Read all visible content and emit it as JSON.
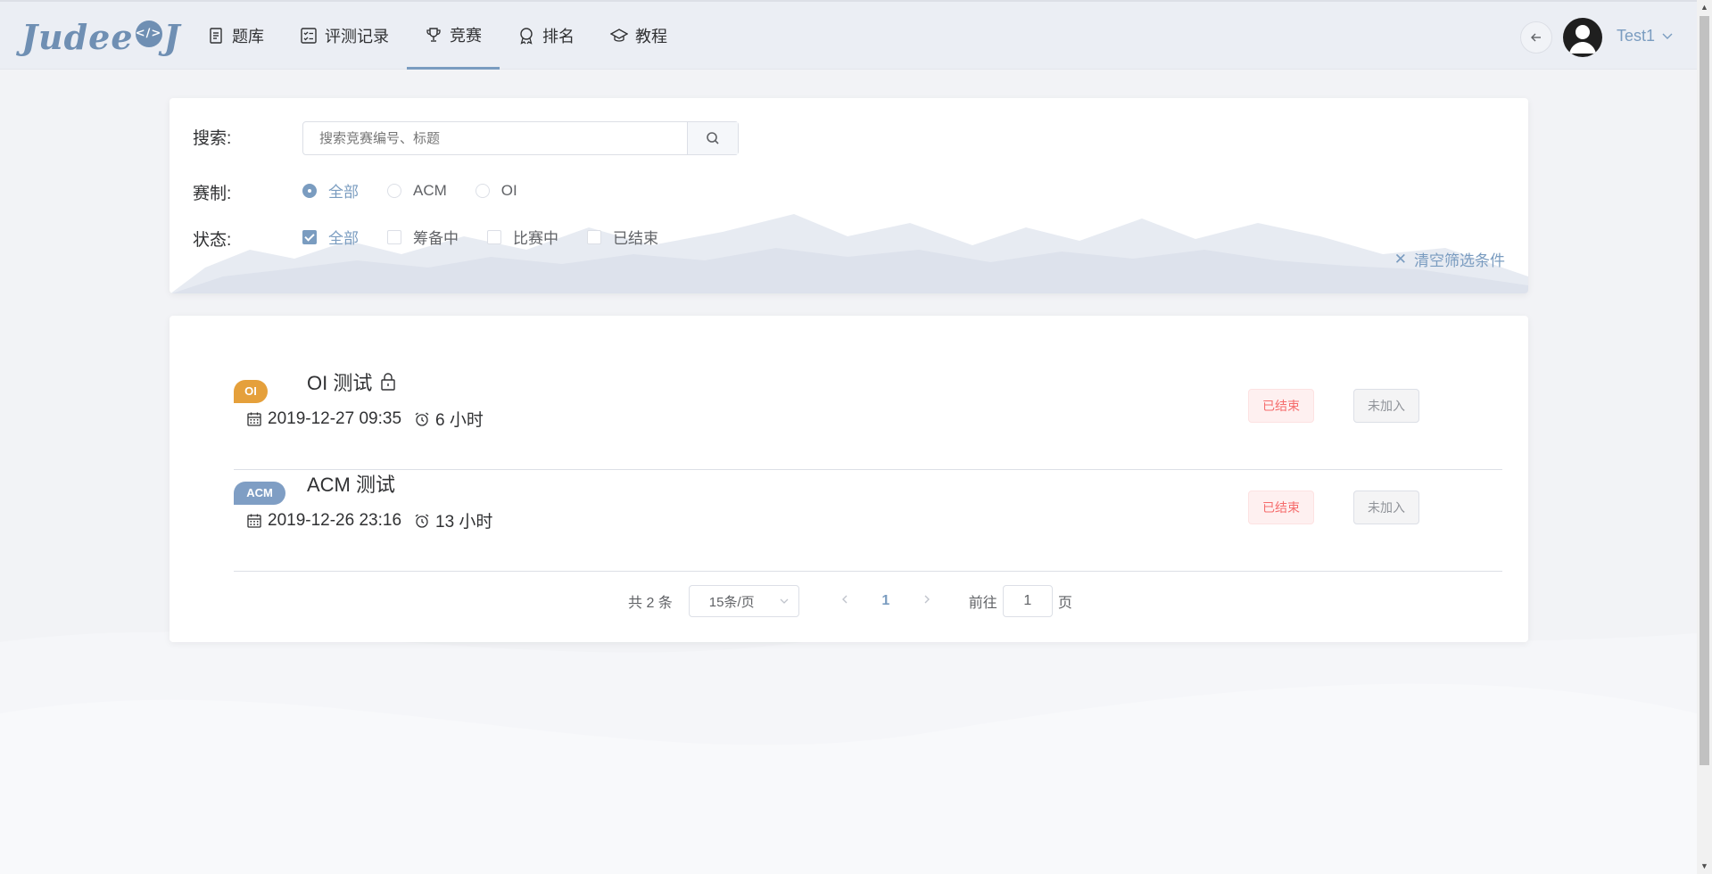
{
  "logo": {
    "text_left": "Judee",
    "bubble": "</>",
    "text_right": "J"
  },
  "nav": {
    "items": [
      {
        "label": "题库",
        "icon": "document-icon"
      },
      {
        "label": "评测记录",
        "icon": "checklist-icon"
      },
      {
        "label": "竞赛",
        "icon": "trophy-icon",
        "active": true
      },
      {
        "label": "排名",
        "icon": "medal-icon"
      },
      {
        "label": "教程",
        "icon": "graduation-cap-icon"
      }
    ]
  },
  "user": {
    "name": "Test1"
  },
  "filter": {
    "search_label": "搜索:",
    "search_placeholder": "搜索竞赛编号、标题",
    "type_label": "赛制:",
    "type_options": [
      "全部",
      "ACM",
      "OI"
    ],
    "type_selected": "全部",
    "status_label": "状态:",
    "status_options": [
      "全部",
      "筹备中",
      "比赛中",
      "已结束"
    ],
    "status_checked": "全部",
    "clear_label": "清空筛选条件"
  },
  "contests": [
    {
      "tag": "OI",
      "title": "OI 测试",
      "locked": true,
      "start": "2019-12-27 09:35",
      "duration": "6 小时",
      "status": "已结束",
      "joined": "未加入"
    },
    {
      "tag": "ACM",
      "title": "ACM 测试",
      "locked": false,
      "start": "2019-12-26 23:16",
      "duration": "13 小时",
      "status": "已结束",
      "joined": "未加入"
    }
  ],
  "pagination": {
    "total": "共 2 条",
    "page_size": "15条/页",
    "current": "1",
    "goto_prefix": "前往",
    "goto_value": "1",
    "goto_suffix": "页"
  },
  "colors": {
    "accent": "#7a9cc0",
    "oi_tag": "#e5a03b",
    "acm_tag": "#7f9ec4",
    "ended": "#f56c6c"
  }
}
